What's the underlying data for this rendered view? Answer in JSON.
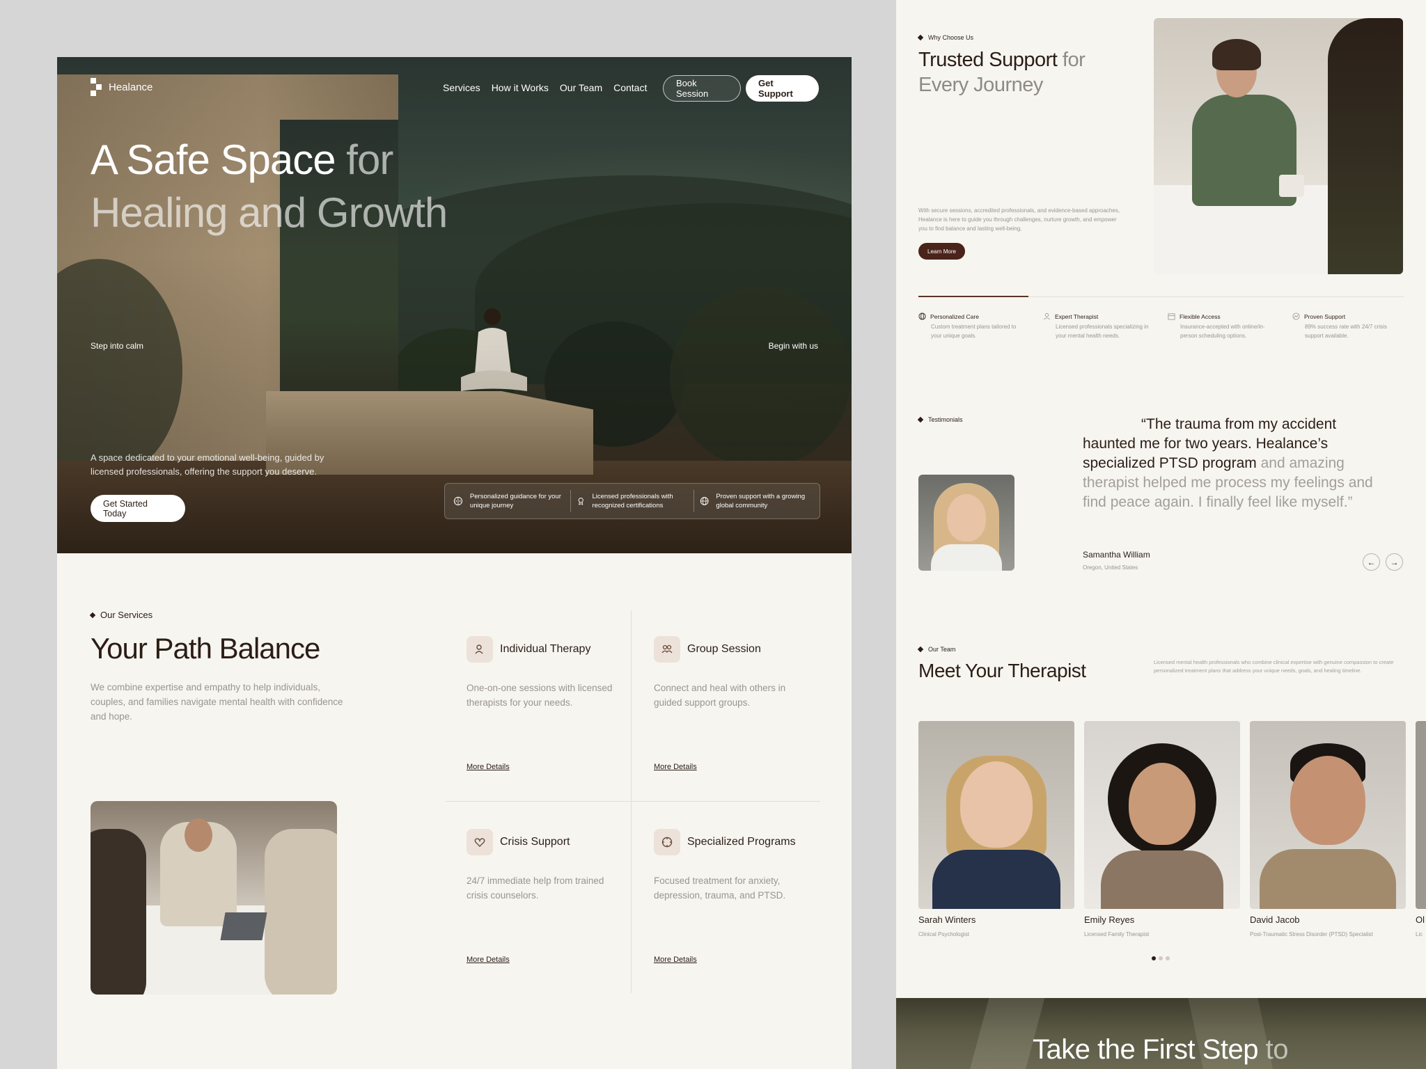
{
  "nav": {
    "brand": "Healance",
    "links": [
      "Services",
      "How it Works",
      "Our Team",
      "Contact"
    ],
    "book_session": "Book Session",
    "get_support": "Get Support"
  },
  "hero": {
    "title_main": "A Safe Space",
    "title_for": " for",
    "title_line2": "Healing and Growth",
    "left_caption": "Step into calm",
    "right_caption": "Begin with us",
    "desc": "A space dedicated to your emotional well-being, guided by licensed professionals, offering the support you deserve.",
    "cta": "Get Started Today",
    "features": [
      {
        "icon": "brain-icon",
        "text": "Personalized guidance for your unique journey"
      },
      {
        "icon": "badge-icon",
        "text": "Licensed professionals with recognized certifications"
      },
      {
        "icon": "globe-icon",
        "text": "Proven support with a growing global community"
      }
    ]
  },
  "services": {
    "tag": "Our Services",
    "title": "Your Path Balance",
    "desc": "We combine expertise and empathy to help individuals, couples, and families navigate mental health with confidence and hope.",
    "more": "More Details",
    "items": [
      {
        "icon": "person-icon",
        "title": "Individual Therapy",
        "desc": "One-on-one sessions with licensed therapists for your needs."
      },
      {
        "icon": "group-icon",
        "title": "Group Session",
        "desc": "Connect and heal with others in guided support groups."
      },
      {
        "icon": "heart-icon",
        "title": "Crisis Support",
        "desc": "24/7 immediate help from trained crisis counselors."
      },
      {
        "icon": "target-icon",
        "title": "Specialized Programs",
        "desc": "Focused treatment for anxiety, depression, trauma, and PTSD."
      }
    ]
  },
  "why": {
    "tag": "Why Choose Us",
    "title_dark": "Trusted Support",
    "title_for": " for",
    "title_line2": "Every Journey",
    "desc": "With secure sessions, accredited professionals, and evidence-based approaches, Healance is here to guide you through challenges, nurture growth, and empower you to find balance and lasting well-being.",
    "learn_more": "Learn More",
    "features": [
      {
        "icon": "globe-icon",
        "title": "Personalized Care",
        "desc": "Custom treatment plans tailored to your unique goals."
      },
      {
        "icon": "person-icon",
        "title": "Expert Therapist",
        "desc": "Licensed professionals specializing in your mental health needs."
      },
      {
        "icon": "calendar-icon",
        "title": "Flexible Access",
        "desc": "Insurance-accepted with online/in-person scheduling options."
      },
      {
        "icon": "chart-icon",
        "title": "Proven Support",
        "desc": "89% success rate with 24/7 crisis support available."
      }
    ]
  },
  "testimonial": {
    "tag": "Testimonials",
    "quote_dark": "“The trauma from my accident haunted me for two years. Healance’s specialized PTSD program",
    "quote_light": " and amazing therapist helped me process my feelings and find peace again. I finally feel like myself.”",
    "name": "Samantha William",
    "location": "Oregon, United States"
  },
  "team": {
    "tag": "Our Team",
    "title": "Meet Your Therapist",
    "desc": "Licensed mental health professionals who combine clinical expertise with genuine compassion to create personalized treatment plans that address your unique needs, goals, and healing timeline.",
    "members": [
      {
        "name": "Sarah Winters",
        "role": "Clinical Psychologist"
      },
      {
        "name": "Emily Reyes",
        "role": "Licensed Family Therapist"
      },
      {
        "name": "David Jacob",
        "role": "Post-Traumatic Stress Disorder (PTSD) Specialist"
      },
      {
        "name": "Ol",
        "role": "Lic"
      }
    ]
  },
  "cta_banner": {
    "title_dark": "Take the First Step",
    "title_light": " to"
  }
}
